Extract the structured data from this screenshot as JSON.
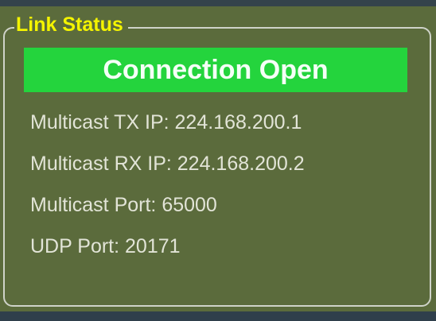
{
  "panel": {
    "title": "Link Status",
    "status_text": "Connection Open",
    "items": [
      "Multicast TX IP: 224.168.200.1",
      "Multicast RX IP: 224.168.200.2",
      "Multicast Port: 65000",
      "UDP Port: 20171"
    ]
  },
  "colors": {
    "panel_background": "#5b6b3c",
    "status_background": "#24d43d",
    "title_text": "#f4f400",
    "info_text": "#e2e4d7"
  }
}
